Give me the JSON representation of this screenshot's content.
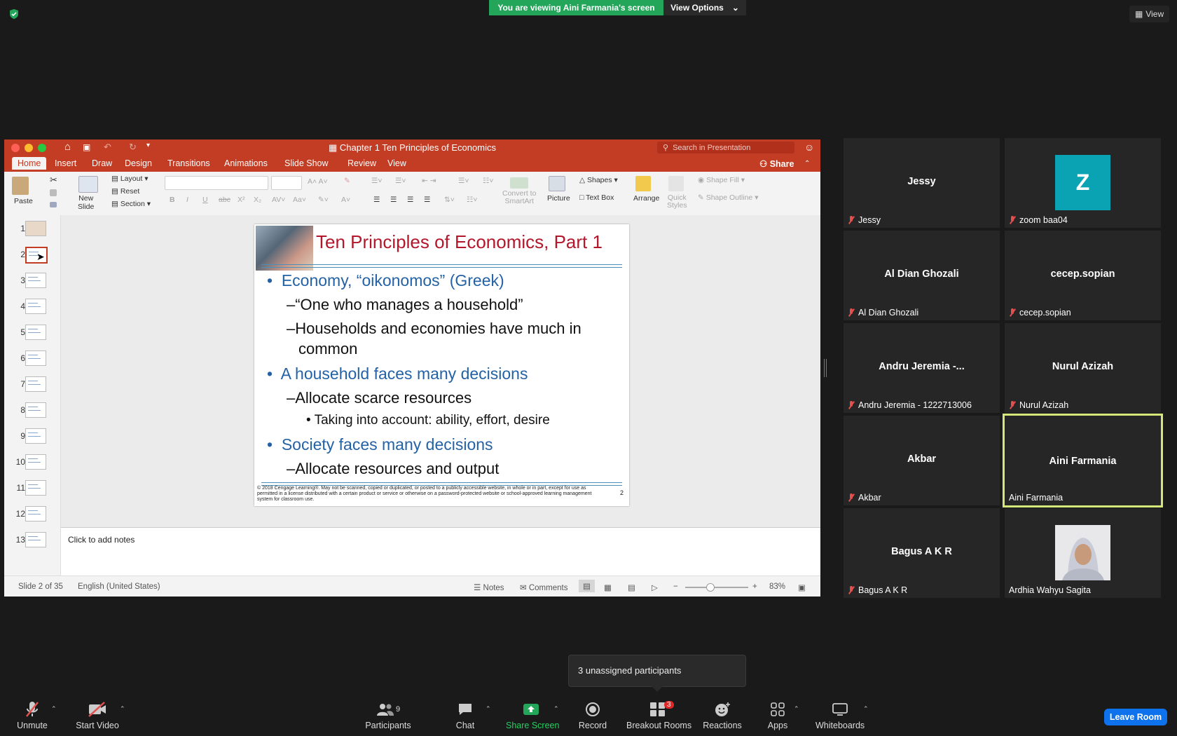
{
  "banner": {
    "viewing": "You are viewing Aini Farmania's screen",
    "view_options": "View Options",
    "view": "View"
  },
  "ppt": {
    "title": "Chapter 1 Ten Principles of Economics",
    "search_placeholder": "Search in Presentation",
    "share": "Share",
    "tabs": [
      "Home",
      "Insert",
      "Draw",
      "Design",
      "Transitions",
      "Animations",
      "Slide Show",
      "Review",
      "View"
    ],
    "ribbon": {
      "paste": "Paste",
      "new_slide": "New\nSlide",
      "layout": "Layout",
      "reset": "Reset",
      "section": "Section",
      "convert": "Convert to\nSmartArt",
      "picture": "Picture",
      "shapes": "Shapes",
      "text_box": "Text Box",
      "arrange": "Arrange",
      "quick_styles": "Quick\nStyles",
      "shape_fill": "Shape Fill",
      "shape_outline": "Shape Outline"
    },
    "thumb_numbers": [
      "1",
      "2",
      "3",
      "4",
      "5",
      "6",
      "7",
      "8",
      "9",
      "10",
      "11",
      "12",
      "13"
    ],
    "slide": {
      "title": "Ten Principles of Economics, Part 1",
      "b1": "Economy, “oikonomos” (Greek)",
      "b1_1": "–“One who manages a household”",
      "b1_2a": "–Households and economies have much in",
      "b1_2b": "common",
      "b2": "A household faces many decisions",
      "b2_1": "–Allocate scarce resources",
      "b2_1_1": "• Taking into account: ability, effort, desire",
      "b3": "Society faces many decisions",
      "b3_1": "–Allocate resources and output",
      "footer": "© 2018 Cengage Learning®. May not be scanned, copied or duplicated, or posted to a publicly accessible website, in whole or in part, except for use as permitted in a license distributed with a certain product or service or otherwise on a password-protected website or school-approved learning management system for classroom use.",
      "number": "2"
    },
    "notes_placeholder": "Click to add notes",
    "status": {
      "slide": "Slide 2 of 35",
      "lang": "English (United States)",
      "notes": "Notes",
      "comments": "Comments",
      "zoom": "83%"
    }
  },
  "participants": [
    {
      "display": "Jessy",
      "label": "Jessy"
    },
    {
      "display": "Z",
      "label": "zoom baa04",
      "avatar_color": "#0aa3b4"
    },
    {
      "display": "Al Dian Ghozali",
      "label": "Al Dian Ghozali"
    },
    {
      "display": "cecep.sopian",
      "label": "cecep.sopian"
    },
    {
      "display": "Andru Jeremia -...",
      "label": "Andru Jeremia - 1222713006"
    },
    {
      "display": "Nurul Azizah",
      "label": "Nurul Azizah"
    },
    {
      "display": "Akbar",
      "label": "Akbar"
    },
    {
      "display": "Aini Farmania",
      "label": "Aini Farmania"
    },
    {
      "display": "Bagus A K R",
      "label": "Bagus A K R"
    },
    {
      "display": "",
      "label": "Ardhia Wahyu Sagita"
    }
  ],
  "tooltip": "3 unassigned participants",
  "toolbar": {
    "unmute": "Unmute",
    "start_video": "Start Video",
    "participants": "Participants",
    "participant_count": "9",
    "chat": "Chat",
    "share_screen": "Share Screen",
    "record": "Record",
    "breakout": "Breakout Rooms",
    "breakout_badge": "3",
    "reactions": "Reactions",
    "apps": "Apps",
    "whiteboards": "Whiteboards",
    "leave": "Leave Room"
  },
  "colors": {
    "ppt_red": "#c33c24",
    "zoom_green": "#23a55a",
    "zoom_blue": "#0e72ed",
    "active_speaker": "#d4e87a"
  }
}
